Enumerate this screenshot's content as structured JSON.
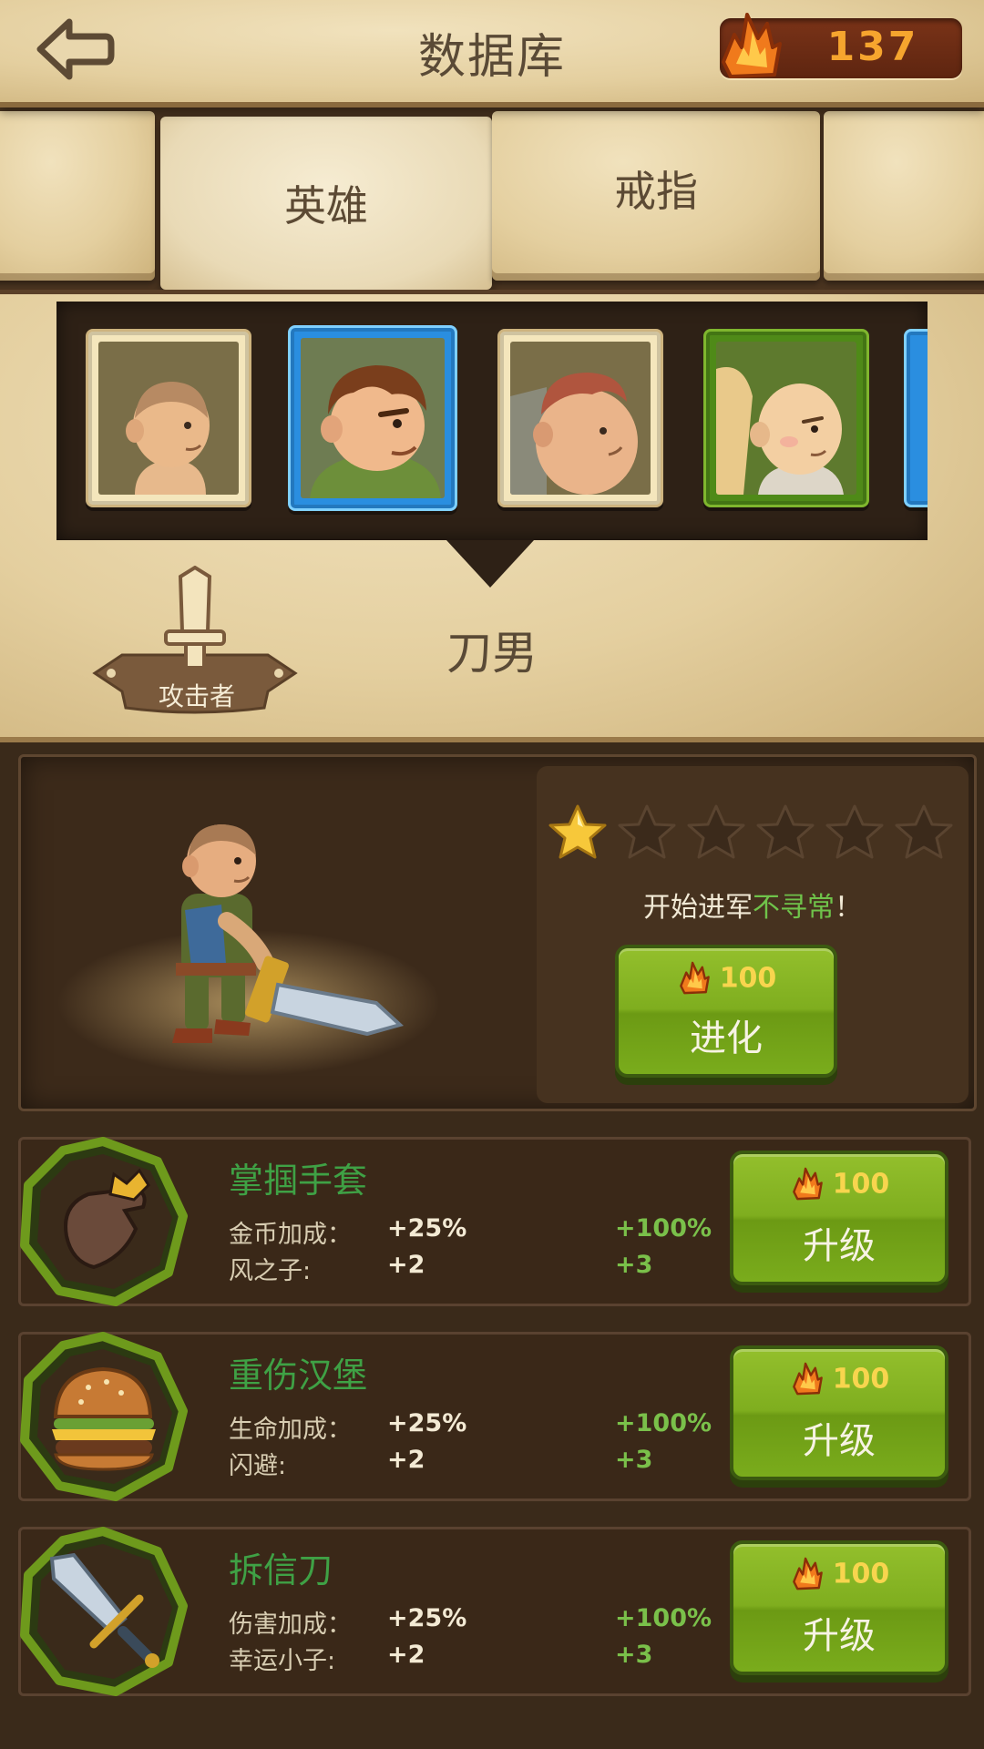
{
  "header": {
    "title": "数据库",
    "crystals": "137"
  },
  "tabs": [
    {
      "label": ""
    },
    {
      "label": "英雄"
    },
    {
      "label": "戒指"
    },
    {
      "label": ""
    }
  ],
  "hero": {
    "name": "刀男",
    "class_label": "攻击者",
    "stars_total": 6,
    "stars_filled": 1,
    "evolve_message_prefix": "开始进军",
    "evolve_message_highlight": "不寻常",
    "evolve_message_suffix": "！",
    "evolve_cost": "100",
    "evolve_label": "进化"
  },
  "items": [
    {
      "name": "掌掴手套",
      "stat1_label": "金币加成：",
      "stat1_current": "+25%",
      "stat1_max": "+100%",
      "stat2_label": "风之子:",
      "stat2_current": "+2",
      "stat2_max": "+3",
      "cost": "100",
      "button_label": "升级"
    },
    {
      "name": "重伤汉堡",
      "stat1_label": "生命加成：",
      "stat1_current": "+25%",
      "stat1_max": "+100%",
      "stat2_label": "闪避:",
      "stat2_current": "+2",
      "stat2_max": "+3",
      "cost": "100",
      "button_label": "升级"
    },
    {
      "name": "拆信刀",
      "stat1_label": "伤害加成：",
      "stat1_current": "+25%",
      "stat1_max": "+100%",
      "stat2_label": "幸运小子:",
      "stat2_current": "+2",
      "stat2_max": "+3",
      "cost": "100",
      "button_label": "升级"
    }
  ],
  "colors": {
    "item_name": "#3fa145",
    "stat_max": "#7ac04a",
    "price": "#f8d54e",
    "button_green": "#7fae1f",
    "crystal_orange": "#f6a52e"
  },
  "icons": {
    "back": "back-arrow-icon",
    "crystal": "crystal-icon",
    "class": "sword-badge-icon",
    "star": "star-icon",
    "item_1": "glove-icon",
    "item_2": "burger-icon",
    "item_3": "dagger-icon"
  }
}
